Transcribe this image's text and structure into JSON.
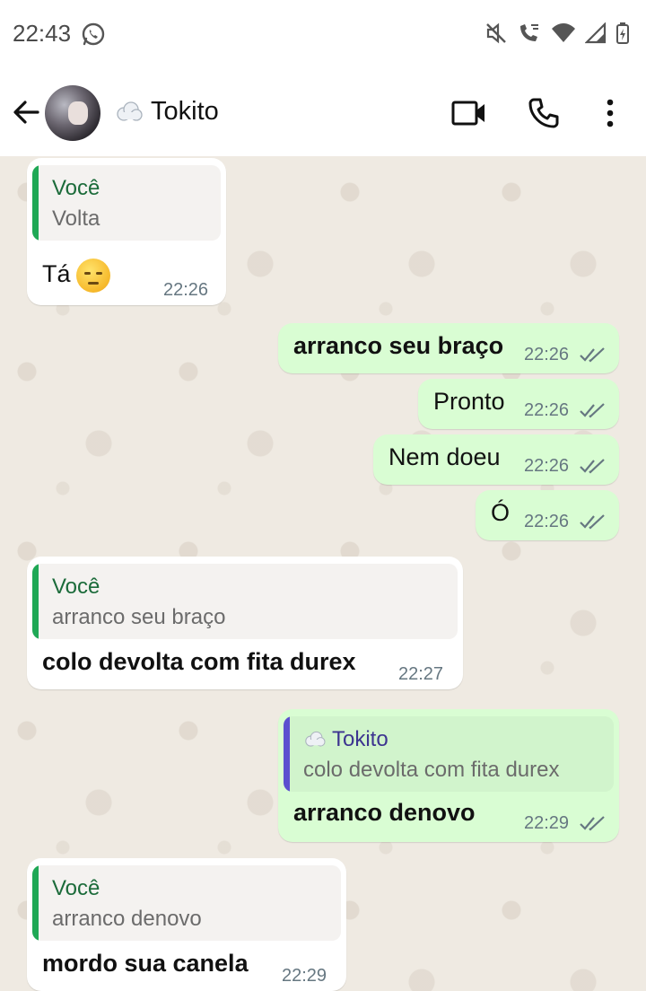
{
  "status_bar": {
    "time": "22:43"
  },
  "header": {
    "contact_name": "Tokito"
  },
  "colors": {
    "in_bubble": "#ffffff",
    "out_bubble": "#d9fdd3",
    "quote_you": "#1fa855",
    "quote_other": "#5b4fcf",
    "tick": "#667781"
  },
  "messages": [
    {
      "direction": "in",
      "quote_author": "Você",
      "quote_text": "Volta",
      "text": "Tá",
      "emoji": "pensive-face",
      "time": "22:26"
    },
    {
      "direction": "out",
      "text": "arranco seu braço",
      "time": "22:26",
      "read": true
    },
    {
      "direction": "out",
      "text": "Pronto",
      "time": "22:26",
      "read": true
    },
    {
      "direction": "out",
      "text": "Nem doeu",
      "time": "22:26",
      "read": true
    },
    {
      "direction": "out",
      "text": "Ó",
      "time": "22:26",
      "read": true
    },
    {
      "direction": "in",
      "quote_author": "Você",
      "quote_text": "arranco seu braço",
      "text": "colo devolta com fita durex",
      "time": "22:27"
    },
    {
      "direction": "out",
      "quote_author": "Tokito",
      "quote_text": "colo devolta com fita durex",
      "text": "arranco denovo",
      "time": "22:29",
      "read": true
    },
    {
      "direction": "in",
      "quote_author": "Você",
      "quote_text": "arranco denovo",
      "text": "mordo sua canela",
      "time": "22:29"
    }
  ]
}
